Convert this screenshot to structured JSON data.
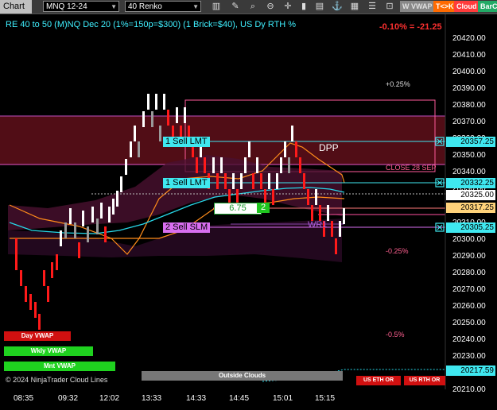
{
  "toolbar": {
    "chart_tab": "Chart",
    "instrument": "MNQ 12-24",
    "period": "40 Renko",
    "buttons": [
      "W VWAP",
      "T<>K",
      "Cloud",
      "BarC"
    ]
  },
  "chart": {
    "title": "RE 40 to 50 (M)NQ Dec 20 (1%=150p=$300) (1 Brick=$40), US Dy RTH %",
    "change": "-0.10% = -21.25",
    "y_ticks": [
      "20420.00",
      "20410.00",
      "20400.00",
      "20390.00",
      "20380.00",
      "20370.00",
      "20360.00",
      "20350.00",
      "20340.00",
      "20330.00",
      "20320.00",
      "20310.00",
      "20300.00",
      "20290.00",
      "20280.00",
      "20270.00",
      "20260.00",
      "20250.00",
      "20240.00",
      "20230.00",
      "20220.00",
      "20210.00"
    ],
    "x_ticks": [
      "08:35",
      "09:32",
      "12:02",
      "13:33",
      "14:33",
      "14:45",
      "15:01",
      "15:15"
    ],
    "price_tags": {
      "sell1": "20357.25",
      "sell2": "20332.25",
      "last": "20325.00",
      "fill": "20317.25",
      "slm": "20305.25",
      "bottom": "20217.59"
    },
    "annotations": {
      "plus": "+0.25%",
      "close": "CLOSE 28 SEP",
      "minus1": "-0.25%",
      "minus2": "-0.5%",
      "dpp": "DPP",
      "wr1": "WR1",
      "outside": "Outside Clouds",
      "copyright": "© 2024 NinjaTrader Cloud Lines",
      "eth": "US ETH OR",
      "rth": "US RTH OR"
    },
    "orders": {
      "sell_lmt_1": "1 Sell LMT",
      "sell_lmt_2": "1 Sell LMT",
      "sell_slm": "2 Sell SLM",
      "pnl": "6.75",
      "qty": "2"
    },
    "vwap_buttons": [
      "Day VWAP",
      "Wkly VWAP",
      "Mnt VWAP"
    ]
  }
}
